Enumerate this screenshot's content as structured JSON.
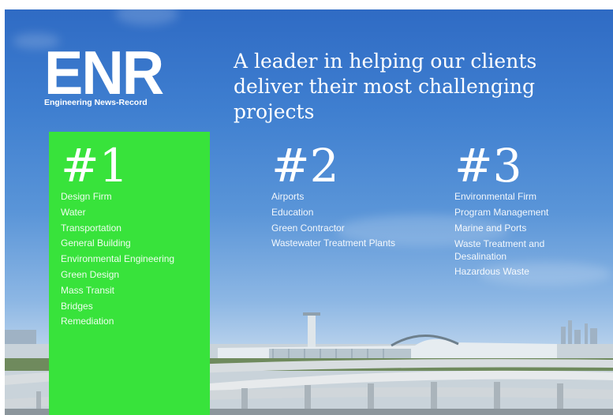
{
  "brand": {
    "logo": "ENR",
    "logo_subtitle": "Engineering News-Record"
  },
  "headline": "A leader in helping our clients deliver their most challenging projects",
  "rankings": [
    {
      "rank": "#1",
      "items": [
        "Design Firm",
        "Water",
        "Transportation",
        "General Building",
        "Environmental Engineering",
        "Green Design",
        "Mass Transit",
        "Bridges",
        "Remediation"
      ]
    },
    {
      "rank": "#2",
      "items": [
        "Airports",
        "Education",
        "Green Contractor",
        "Wastewater Treatment Plants"
      ]
    },
    {
      "rank": "#3",
      "items": [
        "Environmental Firm",
        "Program Management",
        "Marine and Ports",
        "Waste Treatment and Desalination",
        "Hazardous Waste"
      ]
    }
  ],
  "colors": {
    "highlight_green": "#38e33b",
    "sky_blue": "#3f7fd0",
    "text": "#ffffff"
  }
}
